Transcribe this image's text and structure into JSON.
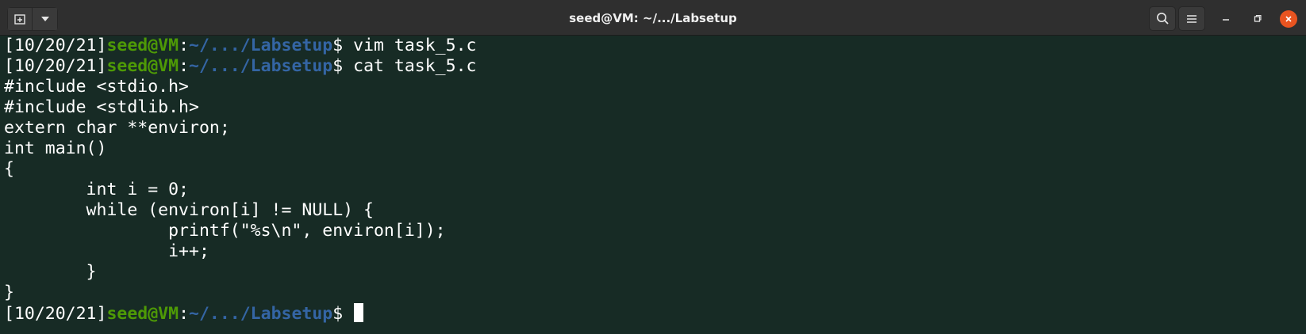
{
  "window": {
    "title": "seed@VM: ~/.../Labsetup"
  },
  "titlebar": {
    "icons": [
      "new-tab-icon",
      "dropdown-arrow-icon",
      "search-icon",
      "hamburger-menu-icon",
      "minimize-icon",
      "maximize-icon",
      "close-icon"
    ]
  },
  "prompt": {
    "date": "[10/20/21]",
    "user_host": "seed@VM",
    "colon": ":",
    "path": "~/.../Labsetup",
    "dollar": "$"
  },
  "commands": [
    " vim task_5.c",
    " cat task_5.c"
  ],
  "output": [
    "#include <stdio.h>",
    "#include <stdlib.h>",
    "extern char **environ;",
    "int main()",
    "{",
    "        int i = 0;",
    "        while (environ[i] != NULL) {",
    "                printf(\"%s\\n\", environ[i]);",
    "                i++;",
    "        }",
    "}"
  ],
  "colors": {
    "background": "#172b25",
    "user_host": "#4e9a06",
    "path": "#3465a4",
    "text": "#ffffff",
    "titlebar": "#2f2f2f",
    "close_button": "#e95420"
  }
}
